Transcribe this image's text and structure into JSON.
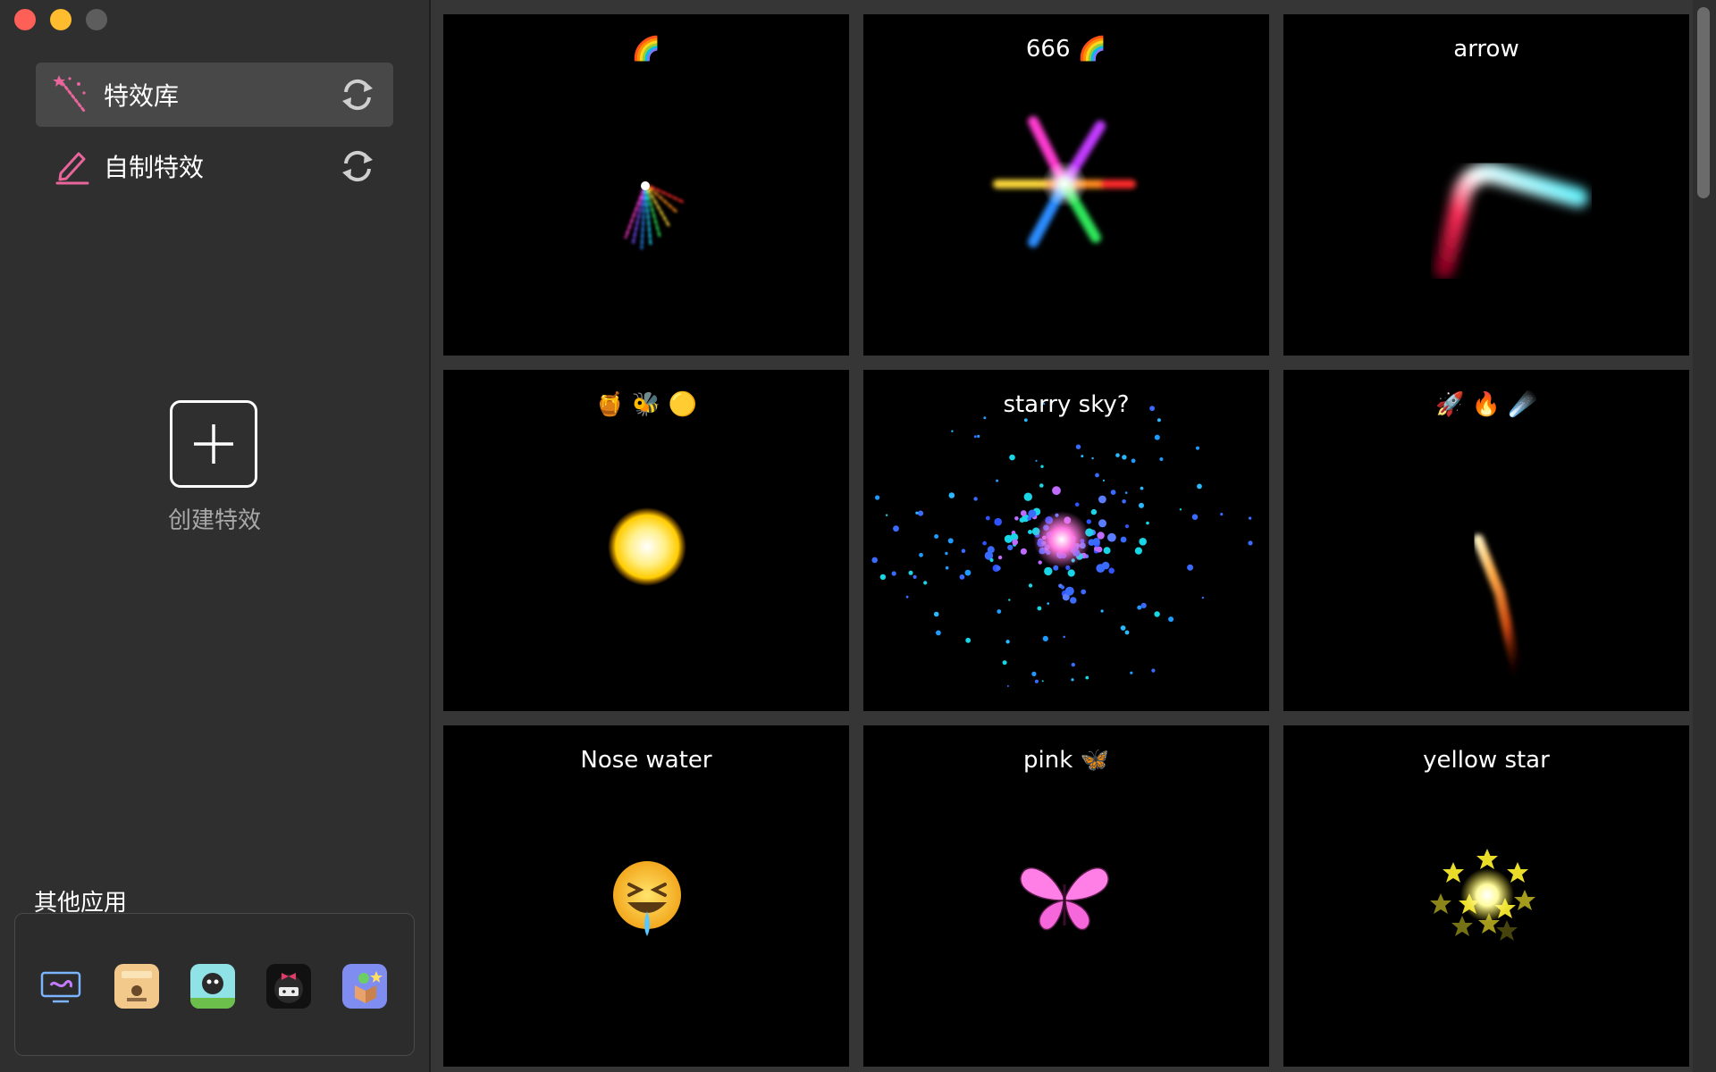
{
  "sidebar": {
    "nav": [
      {
        "label": "特效库",
        "icon": "magic-wand-icon",
        "active": true
      },
      {
        "label": "自制特效",
        "icon": "pencil-icon",
        "active": false
      }
    ],
    "create_label": "创建特效",
    "other_apps_title": "其他应用",
    "other_apps": [
      "display-app-icon",
      "desk-app-icon",
      "monster-app-icon",
      "bow-cat-app-icon",
      "box-app-icon"
    ]
  },
  "effects": [
    {
      "title": "🌈",
      "visual": "rainbow-fan"
    },
    {
      "title": "666 🌈",
      "visual": "rainbow-star"
    },
    {
      "title": "arrow",
      "visual": "neon-arrow"
    },
    {
      "title": "🍯 🐝 🟡",
      "visual": "yellow-glow"
    },
    {
      "title": "starry sky?",
      "visual": "starry-sky"
    },
    {
      "title": "🚀 🔥 ☄️",
      "visual": "fire-trail"
    },
    {
      "title": "Nose water",
      "visual": "crying-emoji"
    },
    {
      "title": "pink 🦋",
      "visual": "pink-butterfly"
    },
    {
      "title": "yellow star",
      "visual": "yellow-stars"
    }
  ],
  "colors": {
    "accent_pink": "#e8659b",
    "sidebar_bg": "#2f2f2f",
    "card_bg": "#000000"
  }
}
